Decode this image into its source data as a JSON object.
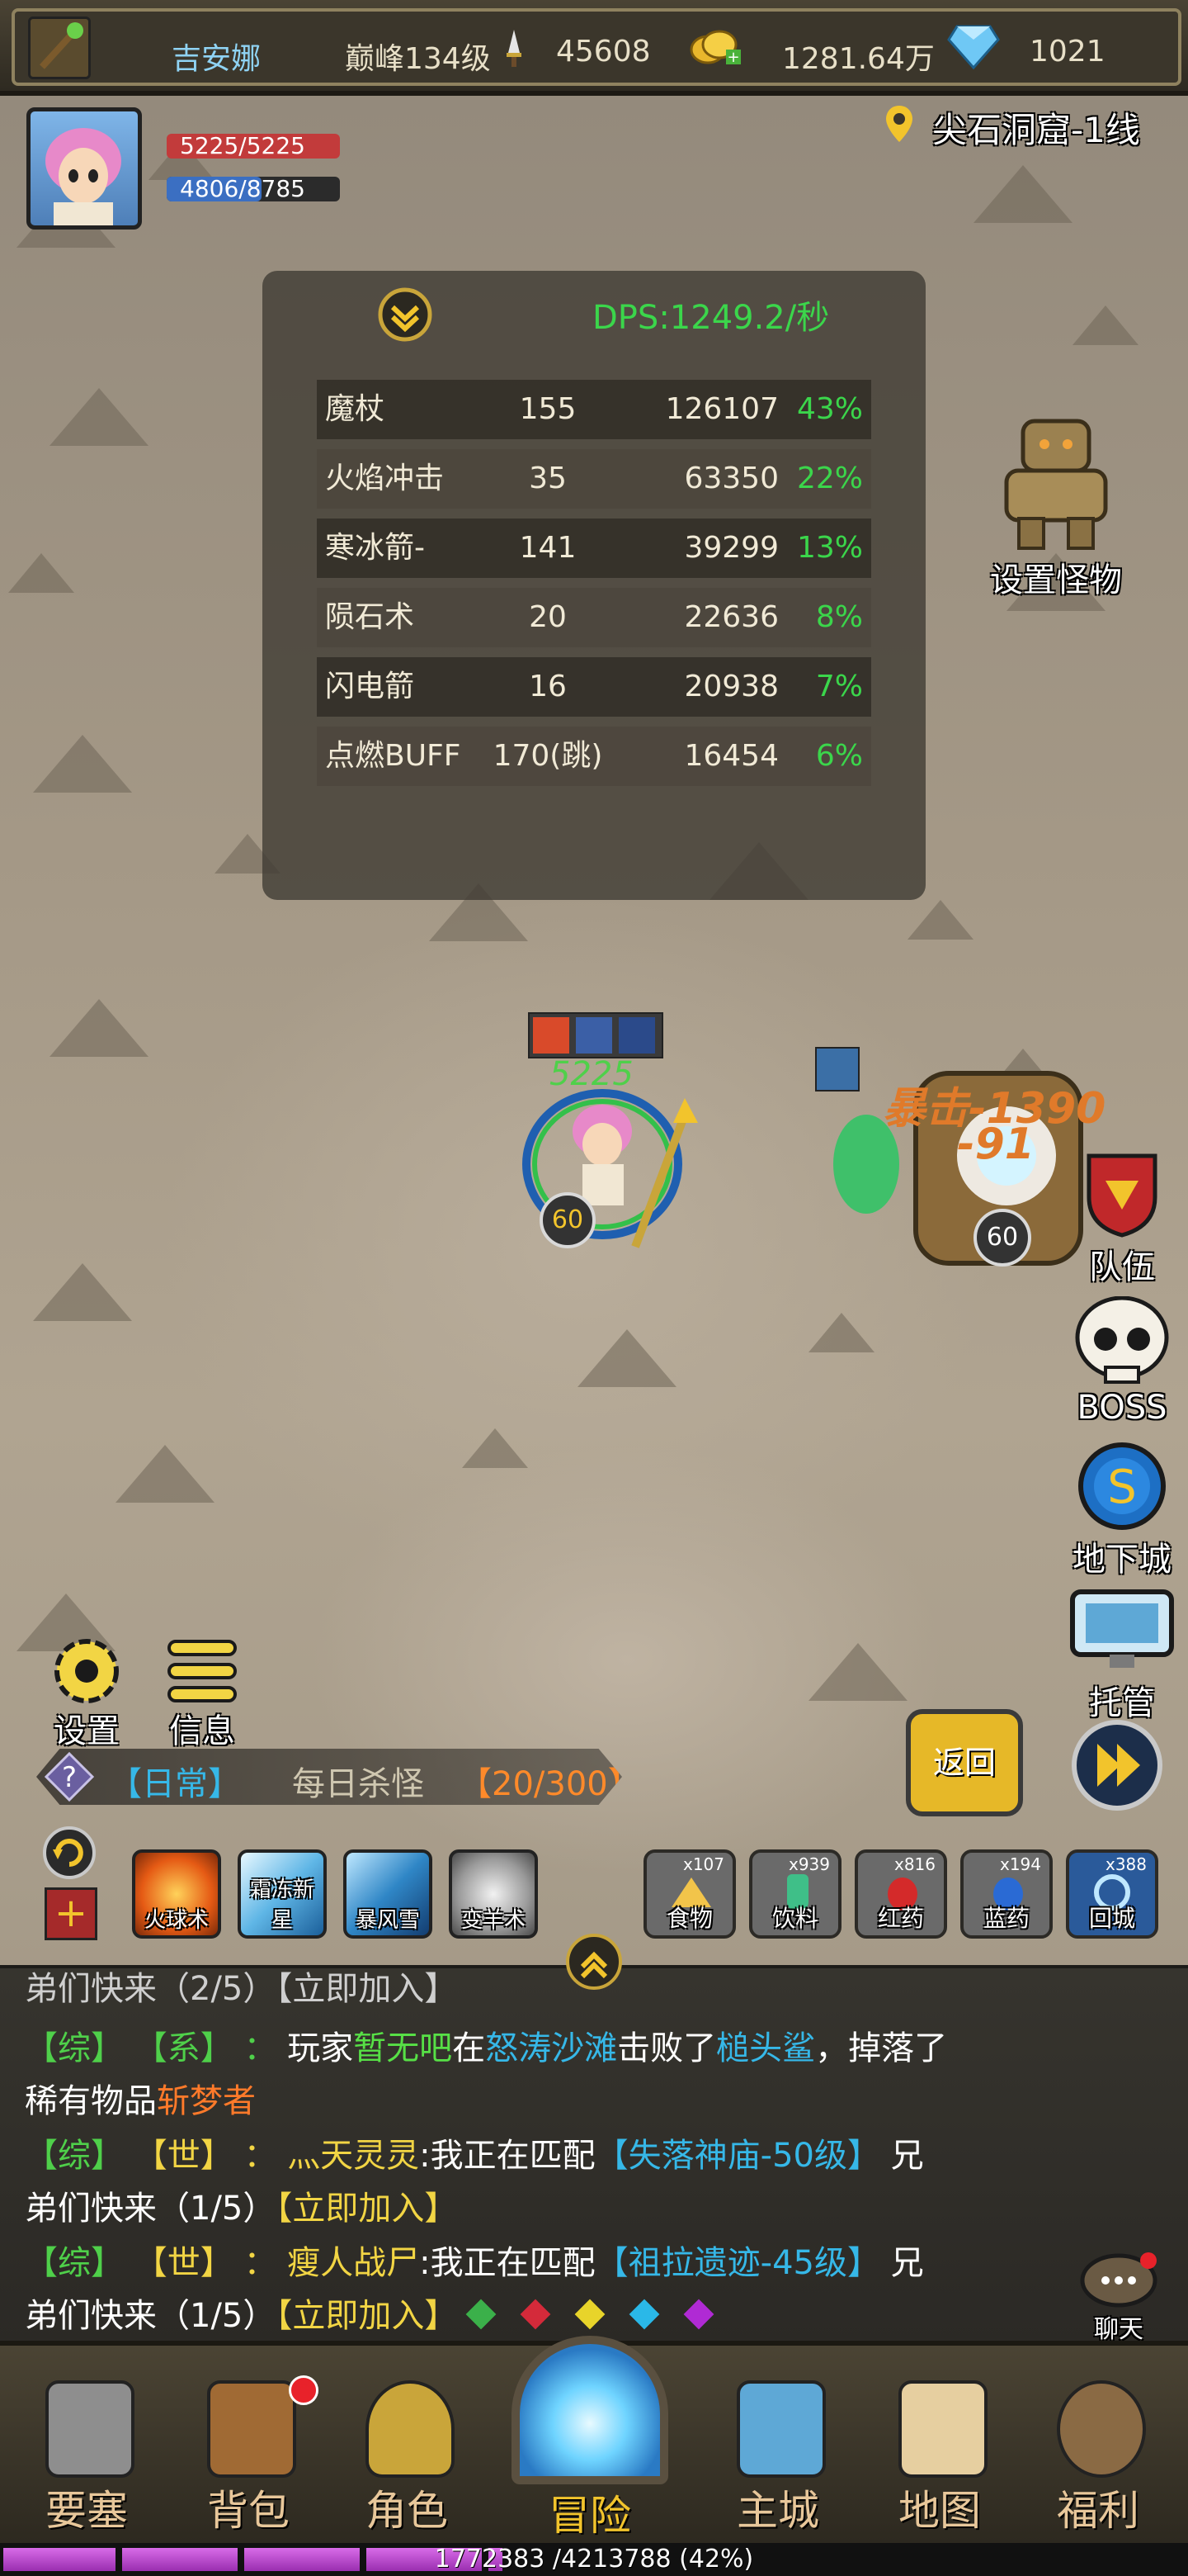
{
  "topbar": {
    "player_name": "吉安娜",
    "level": "巅峰134级",
    "power": "45608",
    "gold": "1281.64万",
    "diamonds": "1021"
  },
  "location": "尖石洞窟-1线",
  "player": {
    "hp": "5225/5225",
    "mp": "4806/8785",
    "hp_fraction": 1.0,
    "mp_fraction": 0.547
  },
  "dps": {
    "title": "DPS:1249.2/秒",
    "rows": [
      {
        "skill": "魔杖",
        "hits": "155",
        "damage": "126107",
        "pct": "43%"
      },
      {
        "skill": "火焰冲击",
        "hits": "35",
        "damage": "63350",
        "pct": "22%"
      },
      {
        "skill": "寒冰箭-",
        "hits": "141",
        "damage": "39299",
        "pct": "13%"
      },
      {
        "skill": "陨石术",
        "hits": "20",
        "damage": "22636",
        "pct": "8%"
      },
      {
        "skill": "闪电箭",
        "hits": "16",
        "damage": "20938",
        "pct": "7%"
      },
      {
        "skill": "点燃BUFF",
        "hits": "170(跳)",
        "damage": "16454",
        "pct": "6%"
      }
    ]
  },
  "battle": {
    "hero_hp_float": "5225",
    "hero_level": "60",
    "enemy_level": "60",
    "crit_text": "暴击-1390",
    "damage_text": "-91"
  },
  "side_buttons": {
    "set_monster": "设置怪物",
    "team": "队伍",
    "boss": "BOSS",
    "dungeon": "地下城",
    "auto": "托管"
  },
  "left_buttons": {
    "settings": "设置",
    "info": "信息"
  },
  "quest": {
    "tag": "【日常】",
    "name": "每日杀怪",
    "progress": "【20/300】"
  },
  "return_button": "返回",
  "skills": [
    {
      "name": "火球术"
    },
    {
      "name": "霜冻新星"
    },
    {
      "name": "暴风雪"
    },
    {
      "name": "变羊术"
    }
  ],
  "items": [
    {
      "name": "食物",
      "count": "x107"
    },
    {
      "name": "饮料",
      "count": "x939"
    },
    {
      "name": "红药",
      "count": "x816"
    },
    {
      "name": "蓝药",
      "count": "x194"
    },
    {
      "name": "回城",
      "count": "x388"
    }
  ],
  "chat": {
    "line0": "弟们快来（2/5）【立即加入】",
    "msg1": {
      "ch": "【综】",
      "type": "【系】",
      "sep": "：",
      "t1": "玩家",
      "player": "暂无吧",
      "t2": "在",
      "place": "怒涛沙滩",
      "t3": "击败了",
      "monster": "槌头鲨",
      "t4": "，掉落了",
      "t5": "稀有物品",
      "item": "斩梦者"
    },
    "msg2": {
      "ch": "【综】",
      "type": "【世】",
      "sep": "：",
      "player": "灬天灵灵",
      "t1": ":我正在匹配",
      "dungeon": "【失落神庙-50级】",
      "t2": "兄",
      "t3": "弟们快来（1/5）",
      "join": "【立即加入】"
    },
    "msg3": {
      "ch": "【综】",
      "type": "【世】",
      "sep": "：",
      "player": "瘦人战尸",
      "t1": ":我正在匹配",
      "dungeon": "【祖拉遗迹-45级】",
      "t2": "兄",
      "t3": "弟们快来（1/5）",
      "join": "【立即加入】"
    },
    "chat_button": "聊天"
  },
  "nav": [
    "要塞",
    "背包",
    "角色",
    "冒险",
    "主城",
    "地图",
    "福利"
  ],
  "xp": {
    "text": "1772383 /4213788 (42%)",
    "fraction": 0.42
  },
  "colors": {
    "hp": "#c23b3b",
    "mp": "#3b6fc2",
    "dps_title": "#3bd64b",
    "pct": "#3bd64b",
    "nav_label": "#e8c79a"
  }
}
